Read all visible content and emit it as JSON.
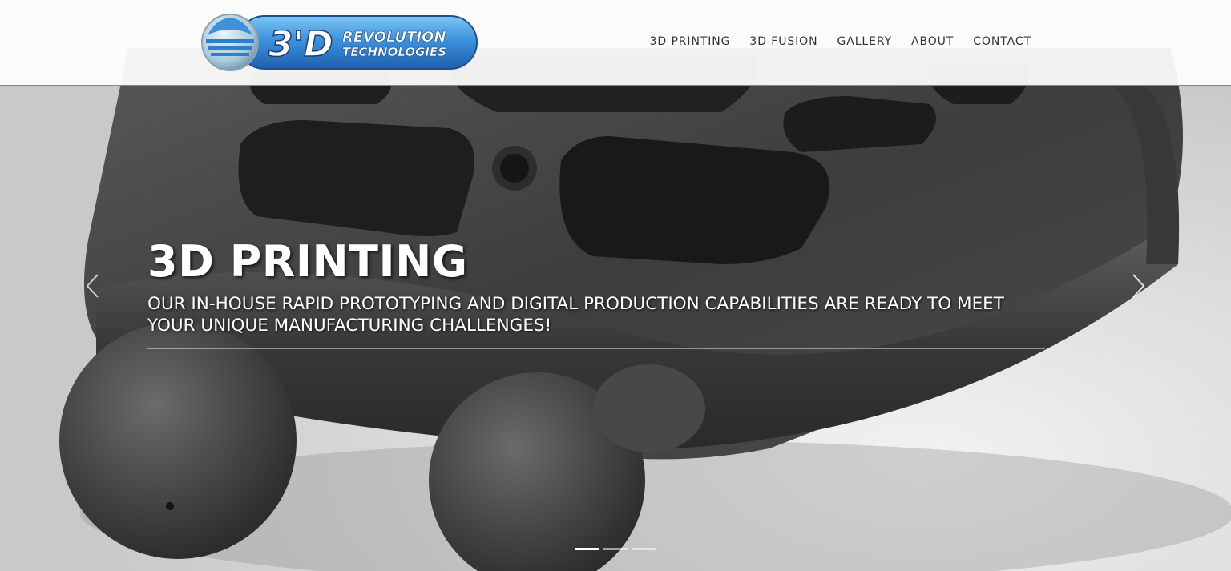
{
  "brand": {
    "logo_alt": "3'D Revolution Technologies",
    "logo_mark": "3'D",
    "logo_line1": "REVOLUTION",
    "logo_line2": "TECHNOLOGIES"
  },
  "nav": {
    "items": [
      {
        "label": "3D PRINTING"
      },
      {
        "label": "3D FUSION"
      },
      {
        "label": "GALLERY"
      },
      {
        "label": "ABOUT"
      },
      {
        "label": "CONTACT"
      }
    ]
  },
  "carousel": {
    "active_slide": 1,
    "slide_count": 3,
    "slide": {
      "title": "3D PRINTING",
      "subtitle": "OUR IN-HOUSE RAPID PROTOTYPING AND DIGITAL PRODUCTION CAPABILITIES ARE READY TO MEET YOUR UNIQUE MANUFACTURING CHALLENGES!"
    },
    "prev_icon": "chevron-left-icon",
    "next_icon": "chevron-right-icon"
  },
  "colors": {
    "header_border": "#3f9fc2",
    "logo_blue": "#2f7fd0",
    "nav_text": "#333333",
    "caption_text": "#ffffff"
  }
}
